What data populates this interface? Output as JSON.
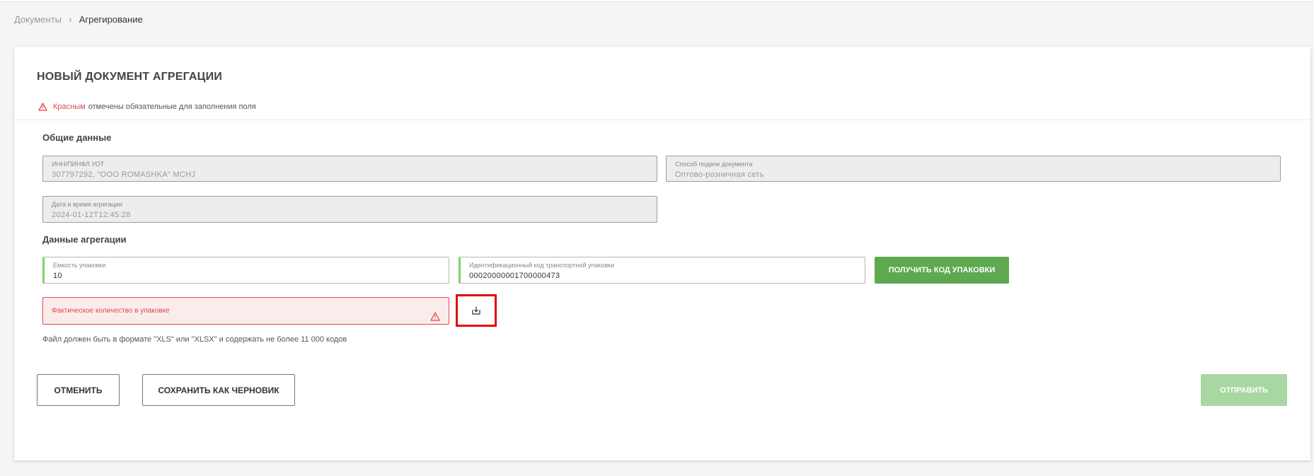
{
  "breadcrumb": {
    "parent": "Документы",
    "separator": "›",
    "current": "Агрегирование"
  },
  "page": {
    "title": "НОВЫЙ ДОКУМЕНТ АГРЕГАЦИИ",
    "required_red_word": "Красным",
    "required_rest": "отмечены обязательные для заполнения поля"
  },
  "general": {
    "section_title": "Общие данные",
    "inn": {
      "label": "ИНН/ПИНФЛ УОТ",
      "value": "307797292, \"OOO ROMASHKA\" MCHJ"
    },
    "submission": {
      "label": "Способ подачи документа",
      "value": "Оптово-розничная сеть"
    },
    "datetime": {
      "label": "Дата и время агрегации",
      "value": "2024-01-12T12:45:28"
    }
  },
  "aggregation": {
    "section_title": "Данные агрегации",
    "capacity": {
      "label": "Емкость упаковки",
      "value": "10"
    },
    "transport_code": {
      "label": "Идентификационный код транспортной упаковки",
      "value": "00020000001700000473"
    },
    "get_code_button": "ПОЛУЧИТЬ КОД УПАКОВКИ",
    "actual_qty": {
      "placeholder": "Фактическое количество в упаковке"
    },
    "file_hint": "Файл должен быть в формате \"XLS\" или \"XLSX\" и содержать не более 11 000 кодов"
  },
  "actions": {
    "cancel": "ОТМЕНИТЬ",
    "save_draft": "СОХРАНИТЬ КАК ЧЕРНОВИК",
    "send": "ОТПРАВИТЬ"
  },
  "icons": {
    "warning": "warning-icon",
    "upload": "upload-icon",
    "chevron": "chevron-right-icon"
  },
  "colors": {
    "accent_green": "#5ea94f",
    "disabled_green": "#a8d8a2",
    "error_red": "#e0464b",
    "highlight_red": "#e10a0a"
  }
}
